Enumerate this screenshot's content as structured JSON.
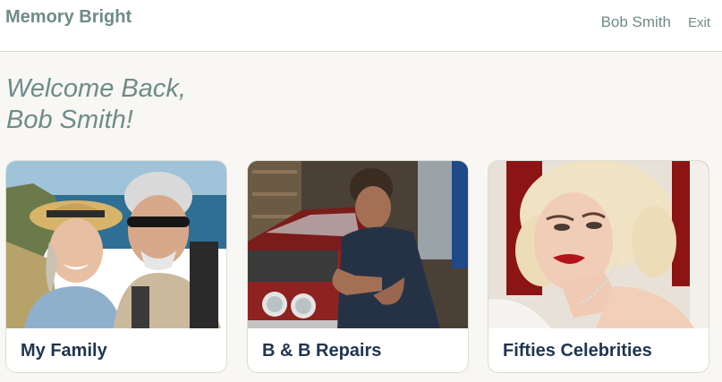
{
  "app": {
    "brand": "Memory Bright"
  },
  "header": {
    "user_name": "Bob Smith",
    "exit_label": "Exit"
  },
  "welcome": {
    "line1": "Welcome Back,",
    "line2": "Bob Smith!"
  },
  "cards": [
    {
      "title": "My Family",
      "image": "smiling-couple-photo"
    },
    {
      "title": "B & B Repairs",
      "image": "mechanic-garage-photo"
    },
    {
      "title": "Fifties Celebrities",
      "image": "celebrity-portrait-photo"
    }
  ],
  "colors": {
    "accent": "#6e8c88",
    "card_title": "#1f3550",
    "background": "#f8f7f4"
  }
}
